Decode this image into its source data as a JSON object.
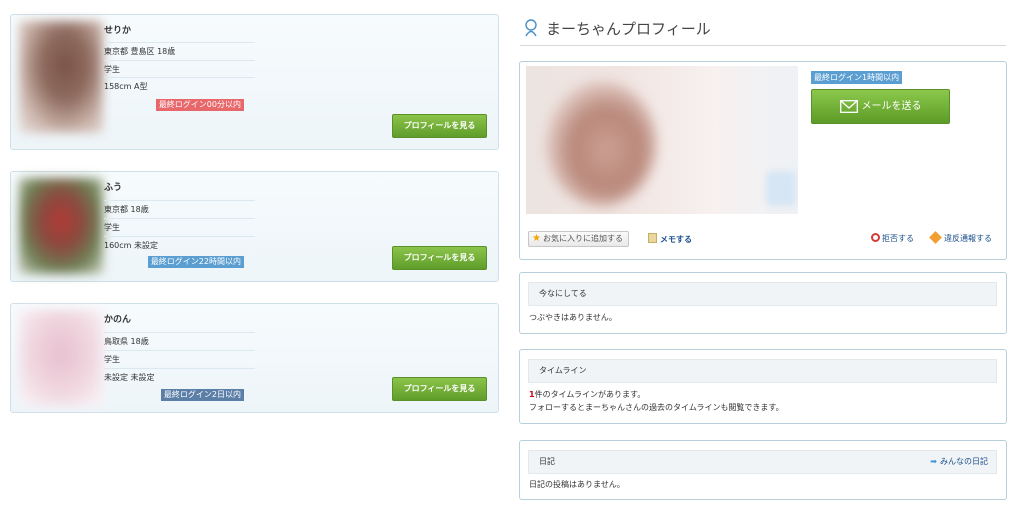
{
  "users": [
    {
      "name": "せりか",
      "location_age": "東京都 豊島区 18歳",
      "occupation": "学生",
      "height_blood": "158cm A型",
      "login": "最終ログイン00分以内",
      "login_color": "#e8676a",
      "view_label": "プロフィールを見る"
    },
    {
      "name": "ふう",
      "location_age": "東京都 18歳",
      "occupation": "学生",
      "height_blood": "160cm 未設定",
      "login": "最終ログイン22時間以内",
      "login_color": "#5b9ed1",
      "view_label": "プロフィールを見る"
    },
    {
      "name": "かのん",
      "location_age": "鳥取県 18歳",
      "occupation": "学生",
      "height_blood": "未設定 未設定",
      "login": "最終ログイン2日以内",
      "login_color": "#5c7fa8",
      "view_label": "プロフィールを見る"
    }
  ],
  "profile": {
    "title": "まーちゃんプロフィール",
    "status": "最終ログイン1時間以内",
    "mail_button": "メールを送る",
    "fav_button": "お気に入りに追加する",
    "memo_link": "メモする",
    "block_link": "拒否する",
    "report_link": "違反通報する"
  },
  "sections": {
    "now": {
      "title": "今なにしてる",
      "text": "つぶやきはありません。"
    },
    "timeline": {
      "title": "タイムライン",
      "count": "1",
      "count_suffix": "件のタイムラインがあります。",
      "note": "フォローするとまーちゃんさんの過去のタイムラインも閲覧できます。"
    },
    "diary": {
      "title": "日記",
      "link": "みんなの日記",
      "text": "日記の投稿はありません。"
    }
  },
  "colors": {
    "accent_green": "#6aa934",
    "link_blue": "#1a4e8a",
    "count_red": "#d0021b"
  }
}
